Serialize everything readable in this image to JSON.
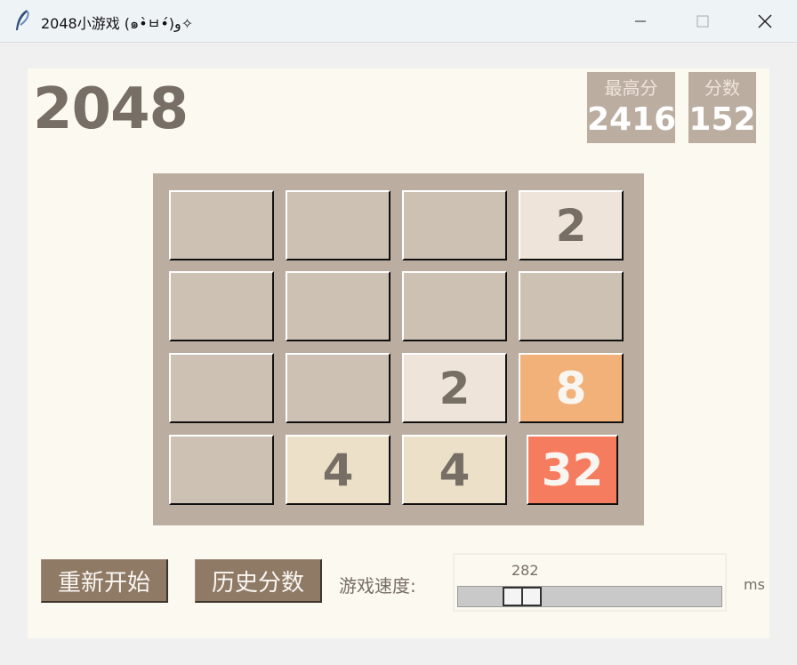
{
  "window": {
    "title": "2048小游戏 (๑•̀ㅂ•́)و✧",
    "minimize_icon": "minimize-icon",
    "maximize_icon": "maximize-icon",
    "close_icon": "close-icon",
    "app_icon": "feather-icon"
  },
  "game": {
    "logo": "2048",
    "best_label": "最高分",
    "best_value": "2416",
    "score_label": "分数",
    "score_value": "152"
  },
  "board": [
    [
      "",
      "",
      "",
      "2"
    ],
    [
      "",
      "",
      "",
      ""
    ],
    [
      "",
      "",
      "2",
      "8"
    ],
    [
      "",
      "4",
      "4",
      "32"
    ]
  ],
  "tile_colors": {
    "empty": "#cdc1b4",
    "2": "#eee4da",
    "4": "#ede0c8",
    "8": "#f2b179",
    "32": "#f67c5f"
  },
  "controls": {
    "restart_label": "重新开始",
    "history_label": "历史分数",
    "speed_label": "游戏速度:",
    "speed_value": "282",
    "speed_unit": "ms"
  },
  "colors": {
    "board_bg": "#bbada0",
    "page_bg": "#fcf9f0",
    "text_dark": "#776e65",
    "button_bg": "#8f7a66"
  }
}
